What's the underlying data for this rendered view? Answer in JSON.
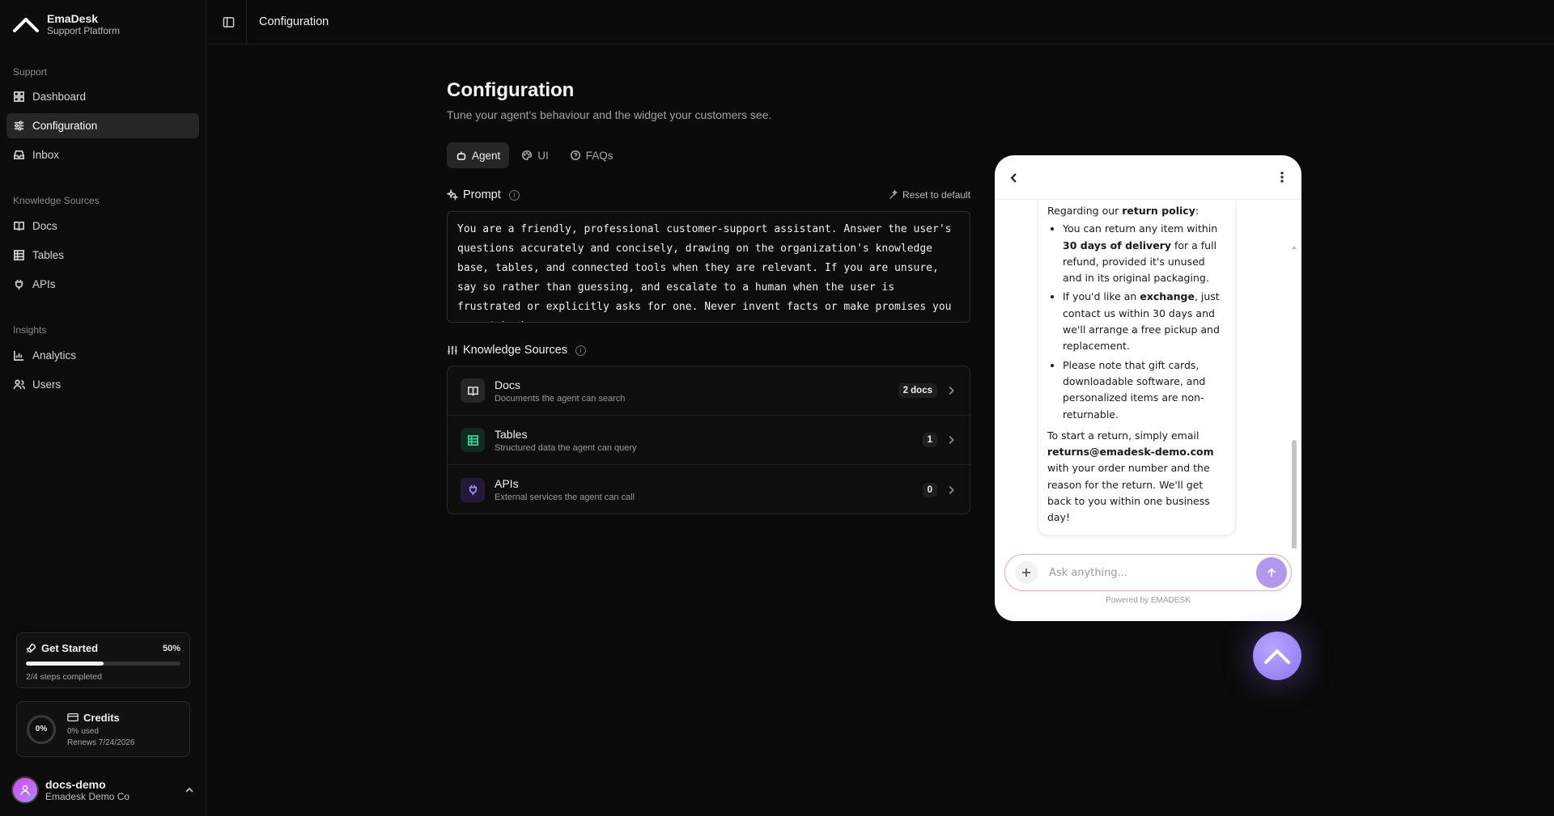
{
  "brand": {
    "name": "EmaDesk",
    "subtitle": "Support Platform"
  },
  "sidebar": {
    "sections": [
      {
        "label": "Support"
      },
      {
        "label": "Knowledge Sources"
      },
      {
        "label": "Insights"
      }
    ],
    "items": [
      {
        "label": "Dashboard",
        "icon": "dashboard-icon"
      },
      {
        "label": "Configuration",
        "icon": "sliders-icon",
        "active": true
      },
      {
        "label": "Inbox",
        "icon": "inbox-icon"
      },
      {
        "label": "Docs",
        "icon": "book-icon"
      },
      {
        "label": "Tables",
        "icon": "table-icon"
      },
      {
        "label": "APIs",
        "icon": "plug-icon"
      },
      {
        "label": "Analytics",
        "icon": "chart-icon"
      },
      {
        "label": "Users",
        "icon": "users-icon"
      }
    ],
    "get_started": {
      "title": "Get Started",
      "percent_label": "50%",
      "progress": 0.5,
      "steps": "2/4 steps completed"
    },
    "credits": {
      "title": "Credits",
      "ring_label": "0%",
      "used": "0% used",
      "renews": "Renews 7/24/2026"
    },
    "user": {
      "name": "docs-demo",
      "org": "Emadesk Demo Co"
    }
  },
  "topbar": {
    "title": "Configuration"
  },
  "main": {
    "title": "Configuration",
    "subtitle": "Tune your agent's behaviour and the widget your customers see.",
    "tabs": [
      {
        "label": "Agent",
        "icon": "bot-icon",
        "active": true
      },
      {
        "label": "UI",
        "icon": "palette-icon"
      },
      {
        "label": "FAQs",
        "icon": "help-icon"
      }
    ],
    "prompt": {
      "heading": "Prompt",
      "reset_label": "Reset to default",
      "text": "You are a friendly, professional customer-support assistant. Answer the user's questions accurately and concisely, drawing on the organization's knowledge base, tables, and connected tools when they are relevant. If you are unsure, say so rather than guessing, and escalate to a human when the user is frustrated or explicitly asks for one. Never invent facts or make promises you cannot back up."
    },
    "knowledge_sources": {
      "heading": "Knowledge Sources",
      "items": [
        {
          "name": "Docs",
          "description": "Documents the agent can search",
          "badge": "2 docs",
          "color": "#d4d4d4",
          "bg": "#262626"
        },
        {
          "name": "Tables",
          "description": "Structured data the agent can query",
          "badge": "1",
          "color": "#34d399",
          "bg": "#0f2a20"
        },
        {
          "name": "APIs",
          "description": "External services the agent can call",
          "badge": "0",
          "color": "#a78bfa",
          "bg": "#231a36"
        }
      ]
    }
  },
  "widget": {
    "intro_pre": "Regarding our ",
    "intro_bold": "return policy",
    "intro_post": ":",
    "bullets": [
      {
        "pre": "You can return any item within ",
        "bold": "30 days of delivery",
        "post": " for a full refund, provided it's unused and in its original packaging."
      },
      {
        "pre": "If you'd like an ",
        "bold": "exchange",
        "post": ", just contact us within 30 days and we'll arrange a free pickup and replacement."
      },
      {
        "pre": "Please note that gift cards, downloadable software, and personalized items are non-returnable.",
        "bold": "",
        "post": ""
      }
    ],
    "outro_pre": "To start a return, simply email ",
    "outro_bold": "returns@emadesk-demo.com",
    "outro_post": " with your order number and the reason for the return. We'll get back to you within one business day!",
    "input_placeholder": "Ask anything...",
    "powered_by": "Powered by EMADESK",
    "accent": "#b497ee"
  }
}
